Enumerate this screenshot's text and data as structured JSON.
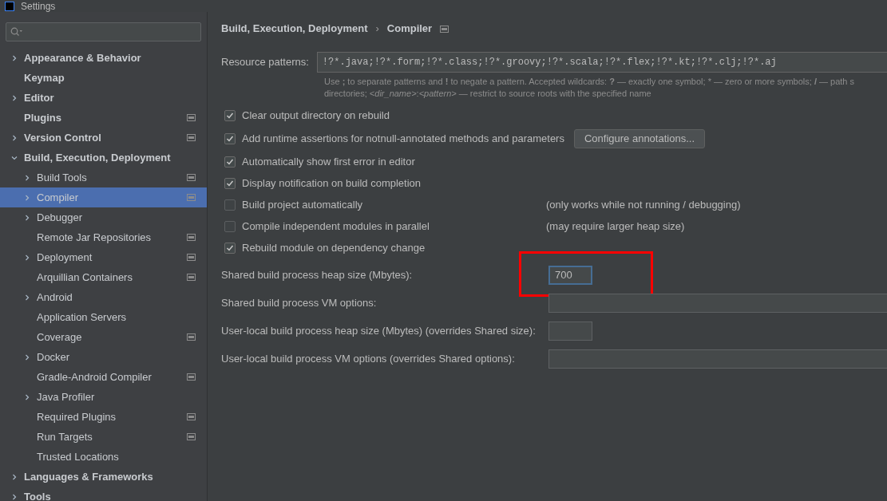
{
  "window": {
    "title": "Settings"
  },
  "sidebar": {
    "items": [
      {
        "label": "Appearance & Behavior",
        "expandable": true,
        "expanded": false,
        "selected": false,
        "badge": false
      },
      {
        "label": "Keymap",
        "expandable": false,
        "selected": false,
        "badge": false
      },
      {
        "label": "Editor",
        "expandable": true,
        "expanded": false,
        "selected": false,
        "badge": false
      },
      {
        "label": "Plugins",
        "expandable": false,
        "selected": false,
        "badge": true
      },
      {
        "label": "Version Control",
        "expandable": true,
        "expanded": false,
        "selected": false,
        "badge": true
      },
      {
        "label": "Build, Execution, Deployment",
        "expandable": true,
        "expanded": true,
        "selected": false,
        "badge": false,
        "children": [
          {
            "label": "Build Tools",
            "expandable": true,
            "selected": false,
            "badge": true
          },
          {
            "label": "Compiler",
            "expandable": true,
            "selected": true,
            "badge": true
          },
          {
            "label": "Debugger",
            "expandable": true,
            "selected": false,
            "badge": false
          },
          {
            "label": "Remote Jar Repositories",
            "expandable": false,
            "selected": false,
            "badge": true
          },
          {
            "label": "Deployment",
            "expandable": true,
            "selected": false,
            "badge": true
          },
          {
            "label": "Arquillian Containers",
            "expandable": false,
            "selected": false,
            "badge": true
          },
          {
            "label": "Android",
            "expandable": true,
            "selected": false,
            "badge": false
          },
          {
            "label": "Application Servers",
            "expandable": false,
            "selected": false,
            "badge": false
          },
          {
            "label": "Coverage",
            "expandable": false,
            "selected": false,
            "badge": true
          },
          {
            "label": "Docker",
            "expandable": true,
            "selected": false,
            "badge": false
          },
          {
            "label": "Gradle-Android Compiler",
            "expandable": false,
            "selected": false,
            "badge": true
          },
          {
            "label": "Java Profiler",
            "expandable": true,
            "selected": false,
            "badge": false
          },
          {
            "label": "Required Plugins",
            "expandable": false,
            "selected": false,
            "badge": true
          },
          {
            "label": "Run Targets",
            "expandable": false,
            "selected": false,
            "badge": true
          },
          {
            "label": "Trusted Locations",
            "expandable": false,
            "selected": false,
            "badge": false
          }
        ]
      },
      {
        "label": "Languages & Frameworks",
        "expandable": true,
        "expanded": false,
        "selected": false,
        "badge": false
      },
      {
        "label": "Tools",
        "expandable": true,
        "expanded": false,
        "selected": false,
        "badge": false
      }
    ]
  },
  "breadcrumb": [
    {
      "label": "Build, Execution, Deployment",
      "separator": "›"
    },
    {
      "label": "Compiler"
    }
  ],
  "resource_patterns": {
    "label": "Resource patterns:",
    "value": "!?*.java;!?*.form;!?*.class;!?*.groovy;!?*.scala;!?*.flex;!?*.kt;!?*.clj;!?*.aj",
    "hint": [
      "Use **;** to separate patterns and **!** to negate a pattern. Accepted wildcards: **?** — exactly one symbol; * — zero or more symbols; **/** — path s",
      "directories; *<dir_name>*:*<pattern>* — restrict to source roots with the specified name"
    ]
  },
  "options": [
    {
      "label": "Clear output directory on rebuild",
      "checked": true
    },
    {
      "label": "Add runtime assertions for notnull-annotated methods and parameters",
      "checked": true,
      "button": "Configure annotations..."
    },
    {
      "label": "Automatically show first error in editor",
      "checked": true
    },
    {
      "label": "Display notification on build completion",
      "checked": true
    },
    {
      "label": "Build project automatically",
      "checked": false,
      "note": "(only works while not running / debugging)"
    },
    {
      "label": "Compile independent modules in parallel",
      "checked": false,
      "note": "(may require larger heap size)"
    },
    {
      "label": "Rebuild module on dependency change",
      "checked": true
    }
  ],
  "fields": [
    {
      "label": "Shared build process heap size (Mbytes):",
      "kind": "short",
      "value": "700",
      "focused": true,
      "highlighted": true
    },
    {
      "label": "Shared build process VM options:",
      "kind": "wide",
      "focused": false,
      "highlighted": false
    },
    {
      "label": "User-local build process heap size (Mbytes) (overrides Shared size):",
      "kind": "short",
      "focused": false,
      "highlighted": false
    },
    {
      "label": "User-local build process VM options (overrides Shared options):",
      "kind": "wide",
      "focused": false,
      "highlighted": false
    }
  ]
}
